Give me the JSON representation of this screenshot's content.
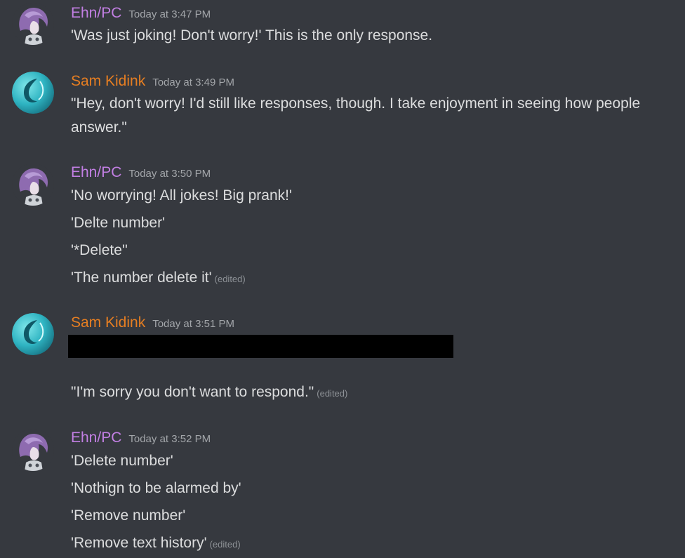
{
  "users": {
    "ehn": {
      "name": "Ehn/PC",
      "color": "#c27fe3",
      "avatar_icon": "purple-haired-character-avatar"
    },
    "sam": {
      "name": "Sam Kidink",
      "color": "#e67e22",
      "avatar_icon": "teal-swirl-avatar"
    }
  },
  "edited_label": "(edited)",
  "groups": [
    {
      "user": "Ehn/PC",
      "timestamp": "Today at 3:47 PM",
      "messages": [
        {
          "text": "'Was just joking! Don't worry!' This is the only response."
        }
      ]
    },
    {
      "user": "Sam Kidink",
      "timestamp": "Today at 3:49 PM",
      "messages": [
        {
          "text": "\"Hey, don't worry! I'd still like responses, though. I take enjoyment in seeing how people answer.\""
        }
      ]
    },
    {
      "user": "Ehn/PC",
      "timestamp": "Today at 3:50 PM",
      "messages": [
        {
          "text": "'No worrying! All jokes! Big prank!'"
        },
        {
          "text": "'Delte number'"
        },
        {
          "text": "'*Delete''"
        },
        {
          "text": "'The number delete it'",
          "edited": true
        }
      ]
    },
    {
      "user": "Sam Kidink",
      "timestamp": "Today at 3:51 PM",
      "redacted": true,
      "messages": [
        {
          "text": "\"I'm sorry you don't want to respond.\"",
          "edited": true
        }
      ]
    },
    {
      "user": "Ehn/PC",
      "timestamp": "Today at 3:52 PM",
      "messages": [
        {
          "text": "'Delete number'"
        },
        {
          "text": "'Nothign to be alarmed by'"
        },
        {
          "text": "'Remove number'"
        },
        {
          "text": "'Remove text history'",
          "edited": true
        }
      ]
    }
  ]
}
